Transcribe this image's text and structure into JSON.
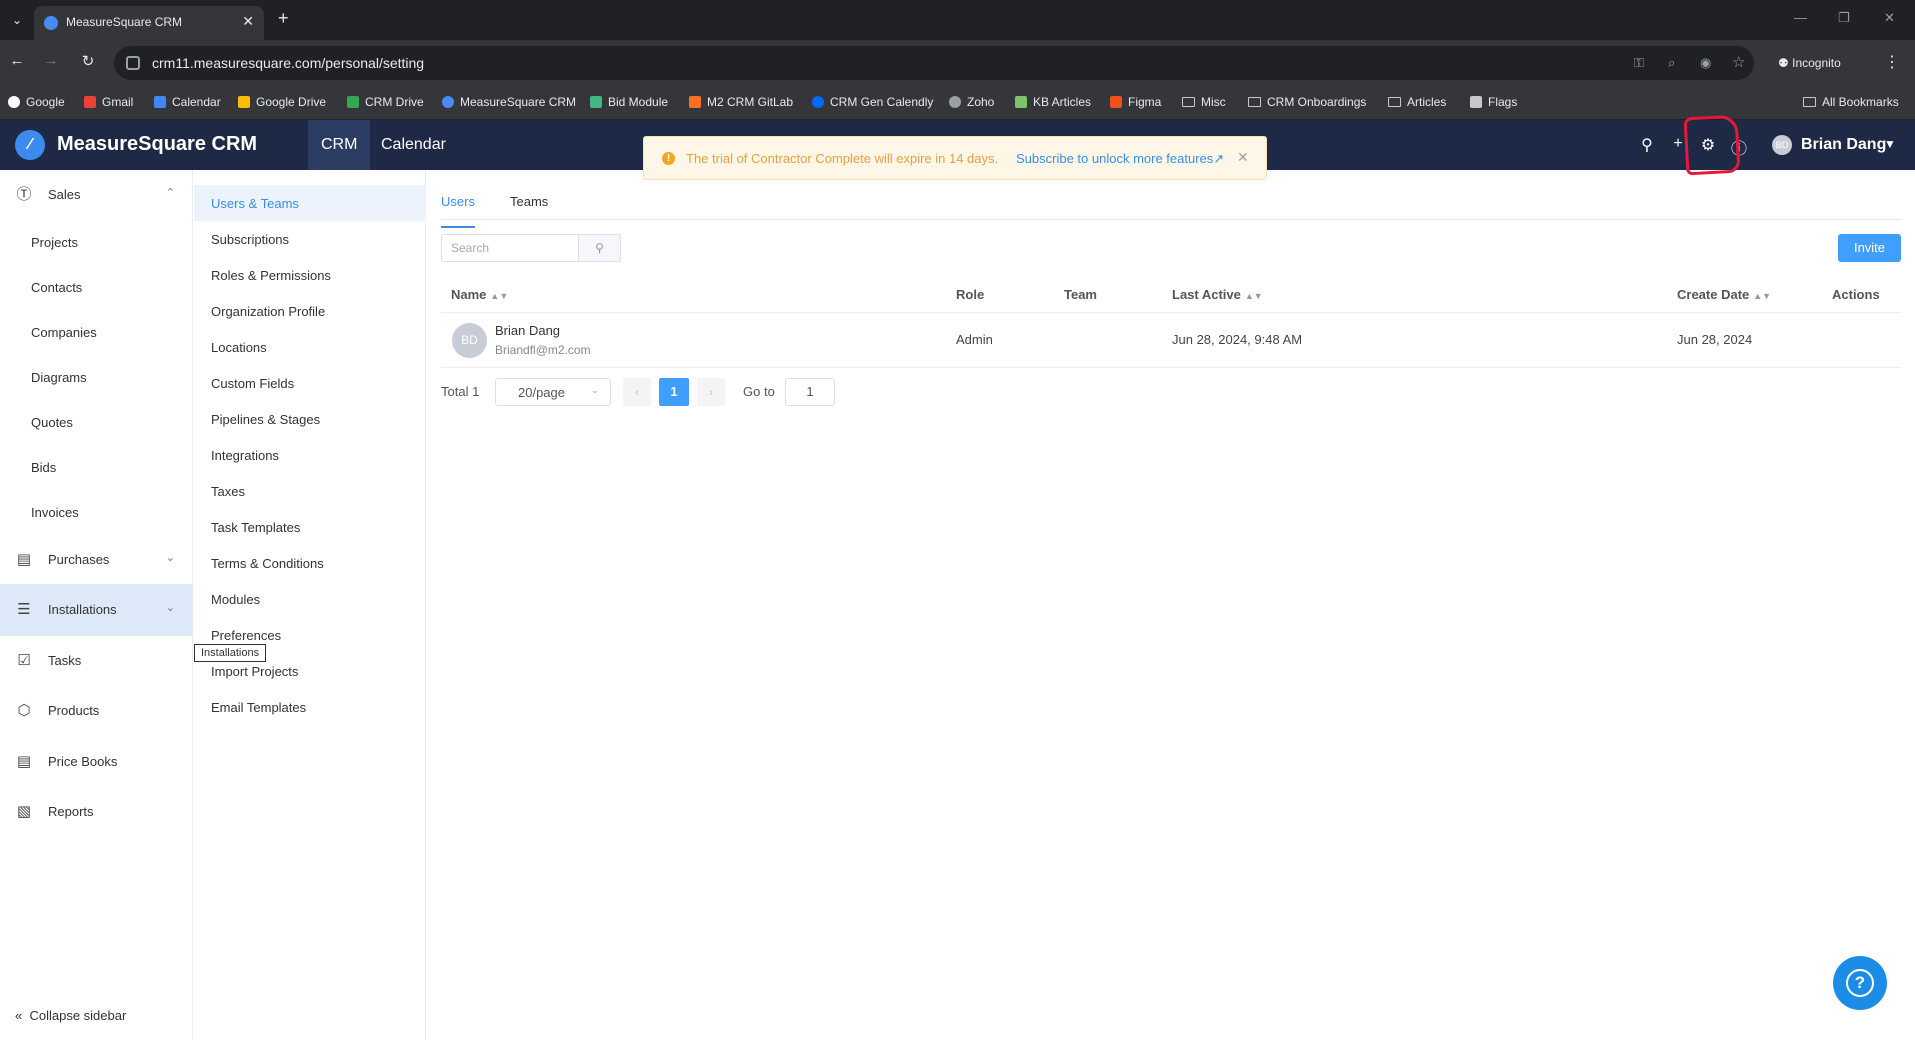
{
  "browser": {
    "tab_title": "MeasureSquare CRM",
    "url": "crm11.measuresquare.com/personal/setting",
    "incognito_label": "Incognito",
    "bookmarks": [
      "Google",
      "Gmail",
      "Calendar",
      "Google Drive",
      "CRM Drive",
      "MeasureSquare CRM",
      "Bid Module",
      "M2 CRM GitLab",
      "CRM Gen Calendly",
      "Zoho",
      "KB Articles",
      "Figma",
      "Misc",
      "CRM Onboardings",
      "Articles",
      "Flags"
    ],
    "all_bookmarks": "All Bookmarks"
  },
  "header": {
    "logo": "MeasureSquare CRM",
    "tabs": [
      "CRM",
      "Calendar"
    ],
    "user_initials": "BD",
    "user_name": "Brian Dang"
  },
  "trial_banner": {
    "message": "The trial of Contractor Complete will expire in 14 days.",
    "link": "Subscribe to unlock more features"
  },
  "sidebar": {
    "sales": "Sales",
    "sales_items": [
      "Projects",
      "Contacts",
      "Companies",
      "Diagrams",
      "Quotes",
      "Bids",
      "Invoices"
    ],
    "purchases": "Purchases",
    "installations": "Installations",
    "tasks": "Tasks",
    "products": "Products",
    "price_books": "Price Books",
    "reports": "Reports",
    "collapse": "Collapse sidebar",
    "tooltip": "Installations"
  },
  "settings_menu": [
    "Users & Teams",
    "Subscriptions",
    "Roles & Permissions",
    "Organization Profile",
    "Locations",
    "Custom Fields",
    "Pipelines & Stages",
    "Integrations",
    "Taxes",
    "Task Templates",
    "Terms & Conditions",
    "Modules",
    "Preferences",
    "Import Projects",
    "Email Templates"
  ],
  "content": {
    "tabs": [
      "Users",
      "Teams"
    ],
    "search_placeholder": "Search",
    "invite_label": "Invite",
    "columns": [
      "Name",
      "Role",
      "Team",
      "Last Active",
      "Create Date",
      "Actions"
    ],
    "rows": [
      {
        "initials": "BD",
        "name": "Brian Dang",
        "email": "Briandfl@m2.com",
        "role": "Admin",
        "team": "",
        "last_active": "Jun 28, 2024, 9:48 AM",
        "create_date": "Jun 28, 2024"
      }
    ],
    "pagination": {
      "total": "Total 1",
      "page_size": "20/page",
      "current_page": "1",
      "goto_label": "Go to",
      "goto_value": "1"
    }
  },
  "colors": {
    "header_bg": "#1e2a45",
    "accent": "#409eff",
    "annotation": "#e5173a"
  }
}
